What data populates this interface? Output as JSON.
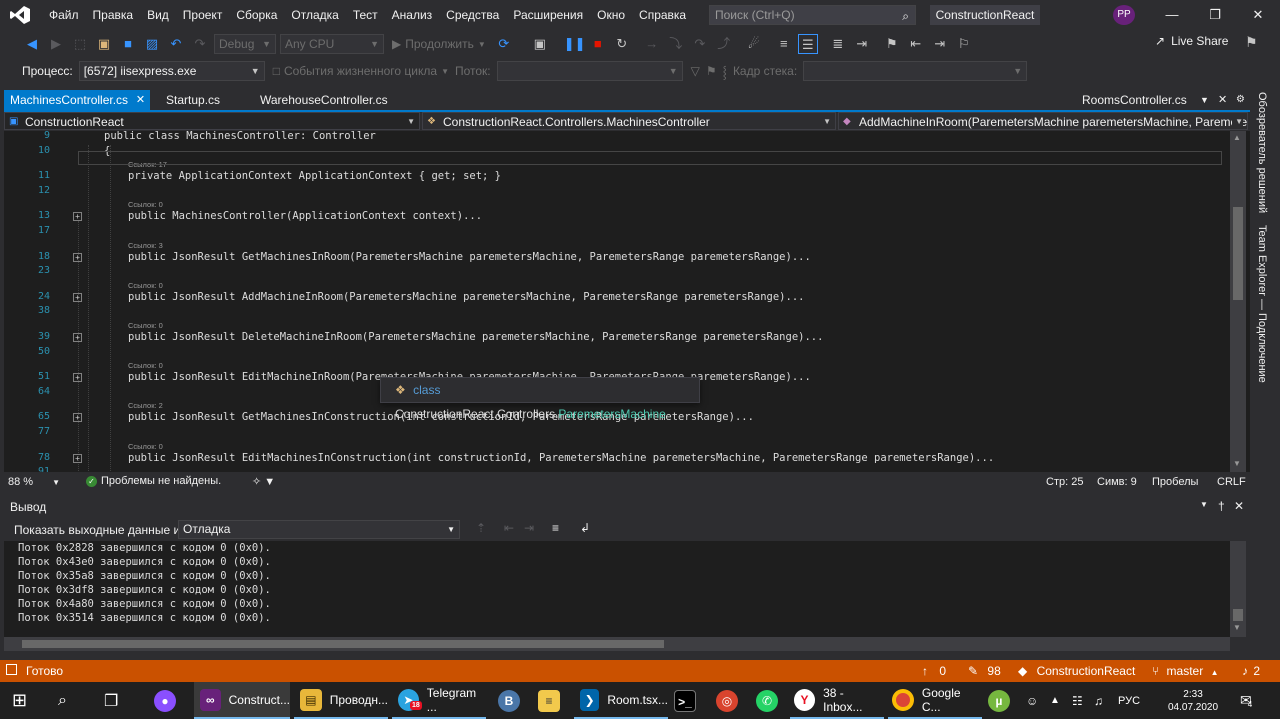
{
  "menubar": {
    "items": [
      "Файл",
      "Правка",
      "Вид",
      "Проект",
      "Сборка",
      "Отладка",
      "Тест",
      "Анализ",
      "Средства",
      "Расширения",
      "Окно",
      "Справка"
    ],
    "search_placeholder": "Поиск (Ctrl+Q)",
    "solution_name": "ConstructionReact",
    "avatar_initials": "PP"
  },
  "toolbar": {
    "config": "Debug",
    "platform": "Any CPU",
    "continue_label": "Продолжить",
    "live_share": "Live Share"
  },
  "debugbar": {
    "process_label": "Процесс:",
    "process_value": "[6572] iisexpress.exe",
    "lifecycle_label": "События жизненного цикла",
    "thread_label": "Поток:",
    "stack_label": "Кадр стека:"
  },
  "tabs": [
    {
      "label": "MachinesController.cs",
      "active": true
    },
    {
      "label": "Startup.cs",
      "active": false
    },
    {
      "label": "WarehouseController.cs",
      "active": false
    },
    {
      "label": "RoomsController.cs",
      "active": false
    }
  ],
  "navbar": {
    "project": "ConstructionReact",
    "class": "ConstructionReact.Controllers.MachinesController",
    "member": "AddMachineInRoom(ParemetersMachine paremetersMachine, ParemetersRa"
  },
  "editor": {
    "lines": [
      {
        "ln": "9",
        "html": "<span class='kw'>public</span> <span class='kw'>class</span> <span class='ty'>MachinesController</span>: <span class='ty'>Controller</span>"
      },
      {
        "ln": "10",
        "html": "{"
      },
      {
        "lens": "Ссылок: 17"
      },
      {
        "ln": "11",
        "html": "    <span class='kw'>private</span> <span class='ty'>ApplicationContext</span> ApplicationContext { <span class='kw'>get</span>; <span class='kw'>set</span>; }"
      },
      {
        "ln": "12",
        "html": ""
      },
      {
        "lens": "Ссылок: 0"
      },
      {
        "ln": "13",
        "fold": true,
        "html": "    <span class='kw'>public</span> <span class='ty'>MachinesController</span>(<span class='ty'>ApplicationContext</span> <span class='pr'>context</span>)<span class='coll'>...</span>"
      },
      {
        "ln": "17",
        "html": ""
      },
      {
        "lens": "Ссылок: 3"
      },
      {
        "ln": "18",
        "fold": true,
        "html": "    <span class='kw'>public</span> <span class='ty'>JsonResult</span> <span class='fn'>GetMachinesInRoom</span>(<span class='ty'>ParemetersMachine</span> <span class='pr'>paremetersMachine</span>, <span class='ty'>ParemetersRange</span> <span class='pr'>paremetersRange</span>)<span class='coll'>...</span>"
      },
      {
        "ln": "23",
        "html": ""
      },
      {
        "lens": "Ссылок: 0"
      },
      {
        "ln": "24",
        "fold": true,
        "html": "    <span class='kw'>public</span> <span class='ty'>JsonResult</span> <span class='fn'>AddMachineInRoom</span>(<span class='ty'>ParemetersMachine</span> <span class='pr'>paremetersMachine</span>, <span class='ty'>ParemetersRange</span> <span class='pr'>paremetersRange</span>)<span class='coll-sel'>...</span>"
      },
      {
        "ln": "38",
        "html": ""
      },
      {
        "lens": "Ссылок: 0"
      },
      {
        "ln": "39",
        "fold": true,
        "html": "    <span class='kw'>public</span> <span class='ty'>JsonResult</span> <span class='fn'>DeleteMachineInRoom</span>(<span class='ty'>ParemetersMachine</span> <span class='pr'>paremetersMachine</span>, <span class='ty'>ParemetersRange</span> <span class='pr'>paremetersRange</span>)<span class='coll'>...</span>"
      },
      {
        "ln": "50",
        "html": ""
      },
      {
        "lens": "Ссылок: 0"
      },
      {
        "ln": "51",
        "fold": true,
        "html": "    <span class='kw'>public</span> <span class='ty'>JsonResult</span> <span class='fn'>EditMachineInRoom</span>(<span class='ty'>ParemetersMachine</span> <span class='pr'>paremetersMachine</span>, <span class='ty'>ParemetersRange</span> <span class='pr'>paremetersRange</span>)<span class='coll'>...</span>"
      },
      {
        "ln": "64",
        "html": ""
      },
      {
        "lens": "Ссылок: 2"
      },
      {
        "ln": "65",
        "fold": true,
        "html": "    <span class='kw'>public</span> <span class='ty'>JsonResult</span> <span class='fn'>GetMachinesInConstruction</span>(<span class='kw'>int</span> <span class='pr'>constructionId</span>, <span class='ty'>ParemetersRange</span> <span class='pr'>paremetersRange</span>)<span class='coll'>...</span>"
      },
      {
        "ln": "77",
        "html": ""
      },
      {
        "lens": "Ссылок: 0"
      },
      {
        "ln": "78",
        "fold": true,
        "html": "    <span class='kw'>public</span> <span class='ty'>JsonResult</span> <span class='fn'>EditMachinesInConstruction</span>(<span class='kw'>int</span> <span class='pr'>constructionId</span>, <span class='ty'>ParemetersMachine</span> <span class='pr'>paremetersMachine</span>, <span class='ty'>ParemetersRange</span> <span class='pr'>paremetersRange</span>)<span class='coll'>...</span>"
      },
      {
        "ln": "91",
        "html": ""
      },
      {
        "lens": "Ссылок: 0"
      }
    ]
  },
  "tooltip": {
    "keyword": "class",
    "namespace": "ConstructionReact.Controllers.",
    "type": "ParemetersMachine"
  },
  "editor_status": {
    "zoom": "88 %",
    "problems": "Проблемы не найдены.",
    "line": "Стр: 25",
    "char": "Симв: 9",
    "spaces": "Пробелы",
    "eol": "CRLF"
  },
  "output": {
    "title": "Вывод",
    "show_label": "Показать выходные данные из:",
    "source": "Отладка",
    "lines": [
      "Поток 0x2828 завершился с кодом 0 (0x0).",
      "Поток 0x43e0 завершился с кодом 0 (0x0).",
      "Поток 0x35a8 завершился с кодом 0 (0x0).",
      "Поток 0x3df8 завершился с кодом 0 (0x0).",
      "Поток 0x4a80 завершился с кодом 0 (0x0).",
      "Поток 0x3514 завершился с кодом 0 (0x0)."
    ]
  },
  "statusbar": {
    "ready": "Готово",
    "up_count": "0",
    "edits_count": "98",
    "repo": "ConstructionReact",
    "branch": "master",
    "notifications": "2"
  },
  "side_panel": {
    "solution_explorer": "Обозреватель решений",
    "team_explorer": "Team Explorer — Подключение"
  },
  "taskbar": {
    "vs_label": "Construct...",
    "explorer_label": "Проводн...",
    "telegram_label": "Telegram ...",
    "telegram_badge": "18",
    "vscode_label": "Room.tsx...",
    "yandex_label": "38 - Inbox...",
    "chrome_label": "Google C...",
    "lang": "РУС",
    "time": "2:33",
    "date": "04.07.2020",
    "notif_count": "4"
  },
  "colors": {
    "accent": "#007acc",
    "statusbar": "#ca5100",
    "editor_bg": "#1e1e1e",
    "chrome_bg": "#2d2d30"
  }
}
